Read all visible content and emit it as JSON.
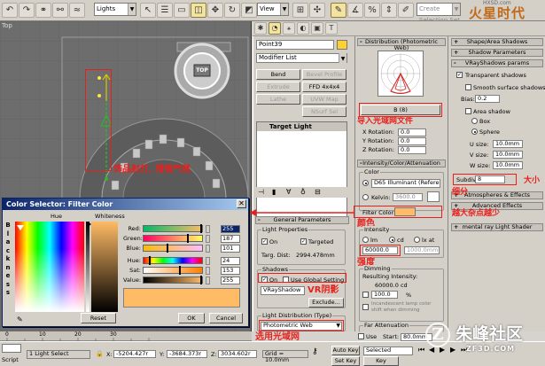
{
  "toolbar": {
    "selection_filter": "Lights",
    "view_dropdown": "View",
    "named_selection": "Create Selection Set"
  },
  "logo": {
    "text": "火星时代",
    "sub": "HXSD.com"
  },
  "viewport": {
    "label": "Top",
    "icon_label": "TOP"
  },
  "modify": {
    "object_name": "Point39",
    "modifier_list": "Modifier List",
    "buttons": [
      "Bend",
      "Bevel Profile",
      "Extrude",
      "FFD 4x4x4",
      "Lathe",
      "UVW Map",
      "",
      "NSurf Sel"
    ],
    "stack_item": "Target Light"
  },
  "distribution": {
    "rollout": "Distribution (Photometric Web)",
    "file_button": "B (8)",
    "x_label": "X Rotation:",
    "x_value": "0.0",
    "y_label": "Y Rotation:",
    "y_value": "0.0",
    "z_label": "Z Rotation:",
    "z_value": "0.0"
  },
  "intensity": {
    "rollout": "Intensity/Color/Attenuation",
    "color_group": "Color",
    "illuminant": "D65 Illuminant (Refere",
    "kelvin_label": "Kelvin:",
    "kelvin_value": "3600.0",
    "filter_label": "Filter Color:",
    "intensity_group": "Intensity",
    "unit_lm": "lm",
    "unit_cd": "cd",
    "unit_lx": "lx at",
    "intensity_value": "60000.0",
    "distance_value": "1000.0mm",
    "dimming_group": "Dimming",
    "resulting_label": "Resulting Intensity:",
    "resulting_value": "60000.0 cd",
    "percent_value": "100.0",
    "percent_unit": "%",
    "incandescent": "Incandescent lamp color shift when dimming",
    "far_group": "Far Attenuation",
    "use_label": "Use",
    "start_label": "Start:",
    "start_value": "80.0mm"
  },
  "general": {
    "rollout": "General Parameters",
    "light_props": "Light Properties",
    "on_label": "On",
    "targeted_label": "Targeted",
    "targ_dist_label": "Targ. Dist:",
    "targ_dist_value": "2994.478mm",
    "shadows_group": "Shadows",
    "shadow_on": "On",
    "use_global": "Use Global Setting",
    "shadow_type": "VRayShadow",
    "exclude_button": "Exclude...",
    "light_dist_group": "Light Distribution (Type)",
    "light_dist_value": "Photometric Web"
  },
  "far_panel": {
    "rollouts": [
      "Shape/Area Shadows",
      "Shadow Parameters",
      "VRayShadows params"
    ],
    "transparent": "Transparent shadows",
    "smooth": "Smooth surface shadows",
    "bias_label": "Bias:",
    "bias_value": "0.2",
    "area_shadow": "Area shadow",
    "box": "Box",
    "sphere": "Sphere",
    "u_label": "U size:",
    "u_value": "10.0mm",
    "v_label": "V size:",
    "v_value": "10.0mm",
    "w_label": "W size:",
    "w_value": "10.0mm",
    "subdivs_label": "Subdivs:",
    "subdivs_value": "8",
    "atmos": "Atmospheres & Effects",
    "advanced": "Advanced Effects",
    "mental_ray": "mental ray Light Shader"
  },
  "color_selector": {
    "title": "Color Selector: Filter Color",
    "hue_header": "Hue",
    "whiteness_header": "Whiteness",
    "blackness": [
      "B",
      "l",
      "a",
      "c",
      "k",
      "n",
      "e",
      "s",
      "s"
    ],
    "red_label": "Red:",
    "red": "255",
    "green_label": "Green:",
    "green": "187",
    "blue_label": "Blue:",
    "blue": "101",
    "hue_label": "Hue:",
    "hue": "24",
    "sat_label": "Sat:",
    "sat": "153",
    "value_label": "Value:",
    "value": "255",
    "reset_button": "Reset",
    "ok_button": "OK",
    "cancel_button": "Cancel",
    "swatch_color": "#ffbb65"
  },
  "annotations": {
    "ies_file": "导入光域网文件",
    "ornament": "饰品射灯, 增强气氛",
    "color": "颜色",
    "intensity": "强度",
    "vr_shadow": "VR阴影",
    "choose_web": "选用光域网",
    "subdiv": "细分",
    "noise": "越大杂点越少",
    "big_small": "大小"
  },
  "statusbar": {
    "selection": "1 Light Select",
    "x_label": "X:",
    "x_value": "-5204.427r",
    "y_label": "Y:",
    "y_value": "-3684.373r",
    "z_label": "Z:",
    "z_value": "3034.602r",
    "grid": "Grid = 10.0mm",
    "autokey": "Auto Key",
    "selected": "Selected",
    "setkey": "Set Key",
    "keyfilters": "Key Filters...",
    "script": "Script",
    "timeline_frames": [
      "0",
      "10",
      "20",
      "30"
    ]
  },
  "watermark": {
    "text": "朱峰社区",
    "url": "ZF3D.COM"
  },
  "colors": {
    "accent": "#e8201c",
    "swatch": "#ffbb65",
    "title": "#0a246a"
  }
}
